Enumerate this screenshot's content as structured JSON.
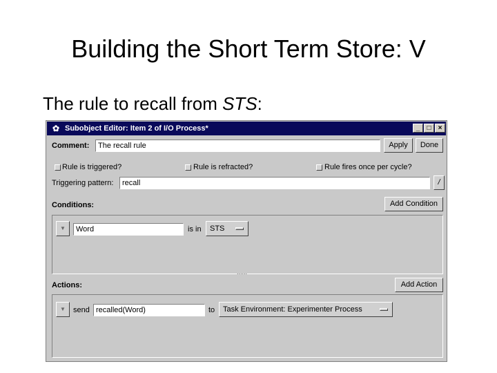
{
  "slide": {
    "title": "Building the Short Term Store: V",
    "subtitle_prefix": "The rule to recall from ",
    "subtitle_emph": "STS",
    "subtitle_suffix": ":"
  },
  "window": {
    "title": "Subobject Editor: Item 2 of I/O Process*",
    "minimize": "_",
    "maximize": "□",
    "close": "×"
  },
  "comment": {
    "label": "Comment:",
    "value": "The recall rule",
    "apply_label": "Apply",
    "done_label": "Done"
  },
  "options": {
    "triggered": "Rule is triggered?",
    "refracted": "Rule is refracted?",
    "once_per_cycle": "Rule fires once per cycle?"
  },
  "trigger": {
    "label": "Triggering pattern:",
    "value": "recall",
    "expand": "/"
  },
  "conditions": {
    "label": "Conditions:",
    "add_label": "Add Condition",
    "row": {
      "toggle": "▼",
      "value": "Word",
      "relation": "is in",
      "store": "STS"
    }
  },
  "actions": {
    "label": "Actions:",
    "add_label": "Add Action",
    "row": {
      "toggle": "▼",
      "verb": "send",
      "value": "recalled(Word)",
      "to": "to",
      "target": "Task Environment: Experimenter Process"
    }
  },
  "splitter": "......"
}
